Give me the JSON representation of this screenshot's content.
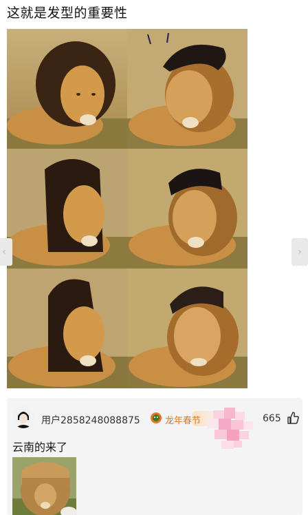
{
  "post": {
    "title": "这就是发型的重要性"
  },
  "images": [
    {
      "icon": "lion-natural-mane-image"
    },
    {
      "icon": "lion-pompadour-hair-image"
    },
    {
      "icon": "lion-long-hair-image"
    },
    {
      "icon": "lion-short-hair-image"
    },
    {
      "icon": "lion-mohawk-hair-image"
    },
    {
      "icon": "lion-human-face-image"
    }
  ],
  "comment": {
    "username": "用户2858248088875",
    "badge_label": "龙年春节",
    "likes": "665",
    "text": "云南的来了",
    "image_icon": "lion-bangs-hair-image"
  },
  "colors": {
    "badge": "#e0781f",
    "card_bg": "#f4f4f5"
  }
}
